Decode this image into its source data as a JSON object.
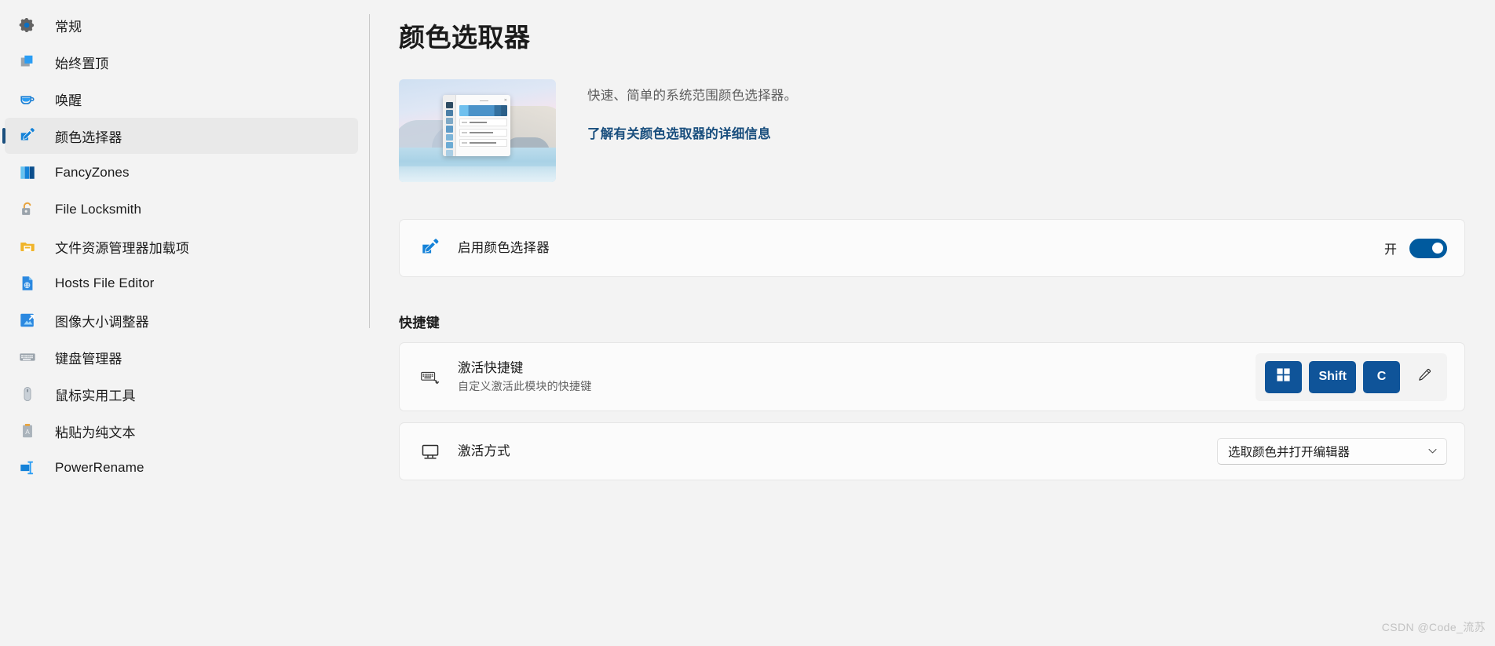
{
  "sidebar": {
    "items": [
      {
        "label": "常规",
        "icon": "gear-icon"
      },
      {
        "label": "始终置顶",
        "icon": "always-on-top-icon"
      },
      {
        "label": "唤醒",
        "icon": "awake-coffee-icon"
      },
      {
        "label": "颜色选择器",
        "icon": "color-picker-eyedropper-icon"
      },
      {
        "label": "FancyZones",
        "icon": "fancyzones-icon"
      },
      {
        "label": "File Locksmith",
        "icon": "file-locksmith-lock-icon"
      },
      {
        "label": "文件资源管理器加载项",
        "icon": "file-explorer-folder-icon"
      },
      {
        "label": "Hosts File Editor",
        "icon": "hosts-file-document-icon"
      },
      {
        "label": "图像大小调整器",
        "icon": "image-resizer-icon"
      },
      {
        "label": "键盘管理器",
        "icon": "keyboard-manager-icon"
      },
      {
        "label": "鼠标实用工具",
        "icon": "mouse-utilities-icon"
      },
      {
        "label": "粘贴为纯文本",
        "icon": "paste-as-plain-text-icon"
      },
      {
        "label": "PowerRename",
        "icon": "power-rename-icon"
      }
    ],
    "selected_index": 3
  },
  "main": {
    "page_title": "颜色选取器",
    "hero": {
      "description": "快速、简单的系统范围颜色选择器。",
      "link_text": "了解有关颜色选取器的详细信息",
      "thumbnail_alt": "颜色选取器预览"
    },
    "enable_card": {
      "icon": "color-picker-eyedropper-icon",
      "title": "启用颜色选择器",
      "toggle_state_label": "开",
      "toggle_on": true
    },
    "shortcut_section": {
      "heading": "快捷键",
      "activation_row": {
        "icon": "keyboard-shortcut-icon",
        "title": "激活快捷键",
        "subtitle": "自定义激活此模块的快捷键",
        "keys": [
          {
            "label": "",
            "icon": "windows-logo-icon"
          },
          {
            "label": "Shift",
            "icon": ""
          },
          {
            "label": "C",
            "icon": ""
          }
        ],
        "edit_icon": "pencil-edit-icon"
      },
      "activation_behavior_row": {
        "icon": "monitor-screen-icon",
        "title": "激活方式",
        "dropdown_value": "选取颜色并打开编辑器",
        "dropdown_chevron": "chevron-down-icon"
      }
    }
  },
  "watermark": "CSDN @Code_流苏",
  "colors": {
    "accent": "#005a9e",
    "key_blue": "#0f5499",
    "link": "#1a4f7e",
    "page_bg": "#f3f3f3",
    "card_bg": "#fbfbfb",
    "selected_nav_bg": "#e9e9e9"
  }
}
